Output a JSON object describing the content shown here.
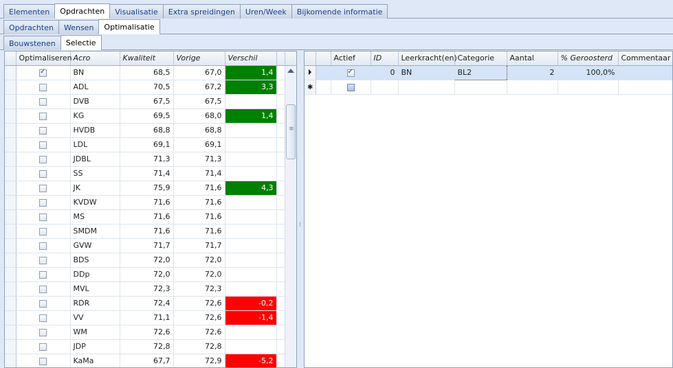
{
  "tabs_main": [
    "Elementen",
    "Opdrachten",
    "Visualisatie",
    "Extra spreidingen",
    "Uren/Week",
    "Bijkomende informatie"
  ],
  "tabs_sub": [
    "Opdrachten",
    "Wensen",
    "Optimalisatie"
  ],
  "tabs_sub2": [
    "Bouwstenen",
    "Selectie"
  ],
  "left_grid": {
    "columns": [
      "Optimaliseren",
      "Acro",
      "Kwaliteit",
      "Vorige",
      "Verschil"
    ],
    "rows": [
      {
        "checked": true,
        "acro": "BN",
        "kwaliteit": "68,5",
        "vorige": "67,0",
        "verschil": "1,4",
        "status": "pos"
      },
      {
        "checked": false,
        "acro": "ADL",
        "kwaliteit": "70,5",
        "vorige": "67,2",
        "verschil": "3,3",
        "status": "pos"
      },
      {
        "checked": false,
        "acro": "DVB",
        "kwaliteit": "67,5",
        "vorige": "67,5",
        "verschil": "",
        "status": ""
      },
      {
        "checked": false,
        "acro": "KG",
        "kwaliteit": "69,5",
        "vorige": "68,0",
        "verschil": "1,4",
        "status": "pos"
      },
      {
        "checked": false,
        "acro": "HVDB",
        "kwaliteit": "68,8",
        "vorige": "68,8",
        "verschil": "",
        "status": ""
      },
      {
        "checked": false,
        "acro": "LDL",
        "kwaliteit": "69,1",
        "vorige": "69,1",
        "verschil": "",
        "status": ""
      },
      {
        "checked": false,
        "acro": "JDBL",
        "kwaliteit": "71,3",
        "vorige": "71,3",
        "verschil": "",
        "status": ""
      },
      {
        "checked": false,
        "acro": "SS",
        "kwaliteit": "71,4",
        "vorige": "71,4",
        "verschil": "",
        "status": ""
      },
      {
        "checked": false,
        "acro": "JK",
        "kwaliteit": "75,9",
        "vorige": "71,6",
        "verschil": "4,3",
        "status": "pos"
      },
      {
        "checked": false,
        "acro": "KVDW",
        "kwaliteit": "71,6",
        "vorige": "71,6",
        "verschil": "",
        "status": ""
      },
      {
        "checked": false,
        "acro": "MS",
        "kwaliteit": "71,6",
        "vorige": "71,6",
        "verschil": "",
        "status": ""
      },
      {
        "checked": false,
        "acro": "SMDM",
        "kwaliteit": "71,6",
        "vorige": "71,6",
        "verschil": "",
        "status": ""
      },
      {
        "checked": false,
        "acro": "GVW",
        "kwaliteit": "71,7",
        "vorige": "71,7",
        "verschil": "",
        "status": ""
      },
      {
        "checked": false,
        "acro": "BDS",
        "kwaliteit": "72,0",
        "vorige": "72,0",
        "verschil": "",
        "status": ""
      },
      {
        "checked": false,
        "acro": "DDp",
        "kwaliteit": "72,0",
        "vorige": "72,0",
        "verschil": "",
        "status": ""
      },
      {
        "checked": false,
        "acro": "MVL",
        "kwaliteit": "72,3",
        "vorige": "72,3",
        "verschil": "",
        "status": ""
      },
      {
        "checked": false,
        "acro": "RDR",
        "kwaliteit": "72,4",
        "vorige": "72,6",
        "verschil": "-0,2",
        "status": "neg"
      },
      {
        "checked": false,
        "acro": "VV",
        "kwaliteit": "71,1",
        "vorige": "72,6",
        "verschil": "-1,4",
        "status": "neg"
      },
      {
        "checked": false,
        "acro": "WM",
        "kwaliteit": "72,6",
        "vorige": "72,6",
        "verschil": "",
        "status": ""
      },
      {
        "checked": false,
        "acro": "JDP",
        "kwaliteit": "72,8",
        "vorige": "72,8",
        "verschil": "",
        "status": ""
      },
      {
        "checked": false,
        "acro": "KaMa",
        "kwaliteit": "67,7",
        "vorige": "72,9",
        "verschil": "-5,2",
        "status": "neg"
      }
    ]
  },
  "right_grid": {
    "columns": [
      "Actief",
      "ID",
      "Leerkracht(en)",
      "Categorie",
      "Aantal",
      "% Geroosterd",
      "Commentaar"
    ],
    "rows": [
      {
        "actief": true,
        "id": "0",
        "leerkracht": "BN",
        "categorie": "BL2",
        "aantal": "2",
        "geroosterd": "100,0%",
        "commentaar": ""
      }
    ]
  },
  "colors": {
    "positive": "#008000",
    "negative": "#ff0000",
    "selection": "#d4e3f7",
    "tab_text": "#15428b"
  }
}
